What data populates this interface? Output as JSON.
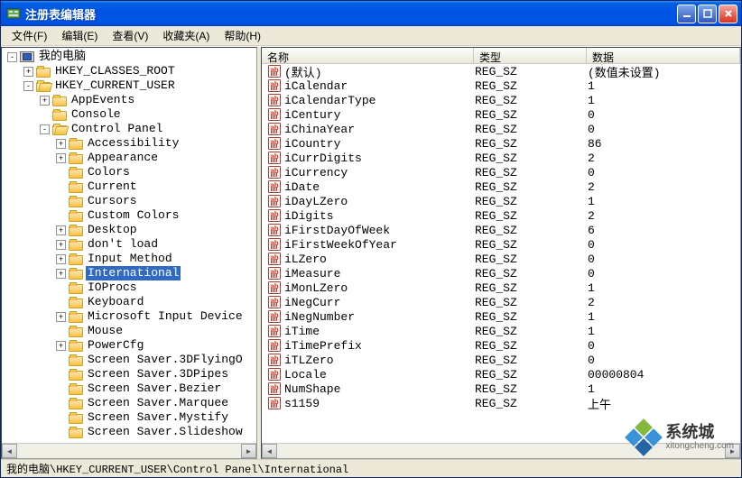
{
  "window": {
    "title": "注册表编辑器"
  },
  "menu": {
    "file": "文件(F)",
    "edit": "编辑(E)",
    "view": "查看(V)",
    "fav": "收藏夹(A)",
    "help": "帮助(H)"
  },
  "list_header": {
    "name": "名称",
    "type": "类型",
    "data": "数据"
  },
  "statusbar": "我的电脑\\HKEY_CURRENT_USER\\Control Panel\\International",
  "tree": [
    {
      "level": 0,
      "exp": "-",
      "icon": "pc",
      "label": "我的电脑"
    },
    {
      "level": 1,
      "exp": "+",
      "icon": "closed",
      "label": "HKEY_CLASSES_ROOT"
    },
    {
      "level": 1,
      "exp": "-",
      "icon": "open",
      "label": "HKEY_CURRENT_USER"
    },
    {
      "level": 2,
      "exp": "+",
      "icon": "closed",
      "label": "AppEvents"
    },
    {
      "level": 2,
      "exp": "",
      "icon": "closed",
      "label": "Console"
    },
    {
      "level": 2,
      "exp": "-",
      "icon": "open",
      "label": "Control Panel"
    },
    {
      "level": 3,
      "exp": "+",
      "icon": "closed",
      "label": "Accessibility"
    },
    {
      "level": 3,
      "exp": "+",
      "icon": "closed",
      "label": "Appearance"
    },
    {
      "level": 3,
      "exp": "",
      "icon": "closed",
      "label": "Colors"
    },
    {
      "level": 3,
      "exp": "",
      "icon": "closed",
      "label": "Current"
    },
    {
      "level": 3,
      "exp": "",
      "icon": "closed",
      "label": "Cursors"
    },
    {
      "level": 3,
      "exp": "",
      "icon": "closed",
      "label": "Custom Colors"
    },
    {
      "level": 3,
      "exp": "+",
      "icon": "closed",
      "label": "Desktop"
    },
    {
      "level": 3,
      "exp": "+",
      "icon": "closed",
      "label": "don't load"
    },
    {
      "level": 3,
      "exp": "+",
      "icon": "closed",
      "label": "Input Method"
    },
    {
      "level": 3,
      "exp": "+",
      "icon": "closed",
      "label": "International",
      "selected": true
    },
    {
      "level": 3,
      "exp": "",
      "icon": "closed",
      "label": "IOProcs"
    },
    {
      "level": 3,
      "exp": "",
      "icon": "closed",
      "label": "Keyboard"
    },
    {
      "level": 3,
      "exp": "+",
      "icon": "closed",
      "label": "Microsoft Input Device"
    },
    {
      "level": 3,
      "exp": "",
      "icon": "closed",
      "label": "Mouse"
    },
    {
      "level": 3,
      "exp": "+",
      "icon": "closed",
      "label": "PowerCfg"
    },
    {
      "level": 3,
      "exp": "",
      "icon": "closed",
      "label": "Screen Saver.3DFlyingO"
    },
    {
      "level": 3,
      "exp": "",
      "icon": "closed",
      "label": "Screen Saver.3DPipes"
    },
    {
      "level": 3,
      "exp": "",
      "icon": "closed",
      "label": "Screen Saver.Bezier"
    },
    {
      "level": 3,
      "exp": "",
      "icon": "closed",
      "label": "Screen Saver.Marquee"
    },
    {
      "level": 3,
      "exp": "",
      "icon": "closed",
      "label": "Screen Saver.Mystify"
    },
    {
      "level": 3,
      "exp": "",
      "icon": "closed",
      "label": "Screen Saver.Slideshow"
    }
  ],
  "values": [
    {
      "name": "(默认)",
      "type": "REG_SZ",
      "data": "(数值未设置)"
    },
    {
      "name": "iCalendar",
      "type": "REG_SZ",
      "data": "1"
    },
    {
      "name": "iCalendarType",
      "type": "REG_SZ",
      "data": "1"
    },
    {
      "name": "iCentury",
      "type": "REG_SZ",
      "data": "0"
    },
    {
      "name": "iChinaYear",
      "type": "REG_SZ",
      "data": "0"
    },
    {
      "name": "iCountry",
      "type": "REG_SZ",
      "data": "86"
    },
    {
      "name": "iCurrDigits",
      "type": "REG_SZ",
      "data": "2"
    },
    {
      "name": "iCurrency",
      "type": "REG_SZ",
      "data": "0"
    },
    {
      "name": "iDate",
      "type": "REG_SZ",
      "data": "2"
    },
    {
      "name": "iDayLZero",
      "type": "REG_SZ",
      "data": "1"
    },
    {
      "name": "iDigits",
      "type": "REG_SZ",
      "data": "2"
    },
    {
      "name": "iFirstDayOfWeek",
      "type": "REG_SZ",
      "data": "6"
    },
    {
      "name": "iFirstWeekOfYear",
      "type": "REG_SZ",
      "data": "0"
    },
    {
      "name": "iLZero",
      "type": "REG_SZ",
      "data": "0"
    },
    {
      "name": "iMeasure",
      "type": "REG_SZ",
      "data": "0"
    },
    {
      "name": "iMonLZero",
      "type": "REG_SZ",
      "data": "1"
    },
    {
      "name": "iNegCurr",
      "type": "REG_SZ",
      "data": "2"
    },
    {
      "name": "iNegNumber",
      "type": "REG_SZ",
      "data": "1"
    },
    {
      "name": "iTime",
      "type": "REG_SZ",
      "data": "1"
    },
    {
      "name": "iTimePrefix",
      "type": "REG_SZ",
      "data": "0"
    },
    {
      "name": "iTLZero",
      "type": "REG_SZ",
      "data": "0"
    },
    {
      "name": "Locale",
      "type": "REG_SZ",
      "data": "00000804"
    },
    {
      "name": "NumShape",
      "type": "REG_SZ",
      "data": "1"
    },
    {
      "name": "s1159",
      "type": "REG_SZ",
      "data": "上午"
    }
  ],
  "watermark": {
    "cn": "系统城",
    "en": "xitongcheng.com"
  }
}
